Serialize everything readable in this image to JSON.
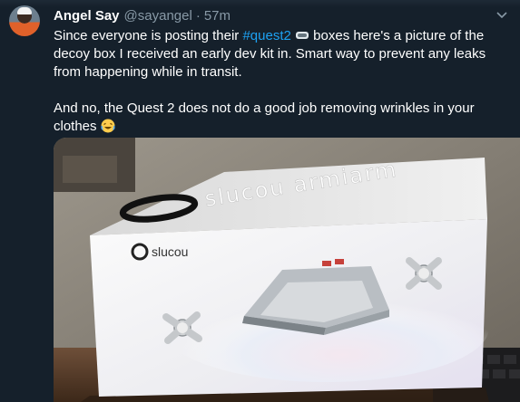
{
  "tweet": {
    "author_name": "Angel Say",
    "author_handle": "@sayangel",
    "separator": "·",
    "time": "57m",
    "line1_before": "Since everyone is posting their ",
    "hashtag": "#quest2",
    "line1_after": " boxes here's a picture of the decoy box I received an early dev kit in. Smart way to prevent any leaks from happening while in transit.",
    "line2": "And no, the Quest 2 does not do a good job removing wrinkles in your clothes",
    "icons": [
      "caret-down-icon",
      "headset-emoji-icon",
      "laughing-emoji-icon"
    ]
  },
  "media": {
    "box_brand_large": "slucou armiarm",
    "box_brand_small": "slucou"
  }
}
